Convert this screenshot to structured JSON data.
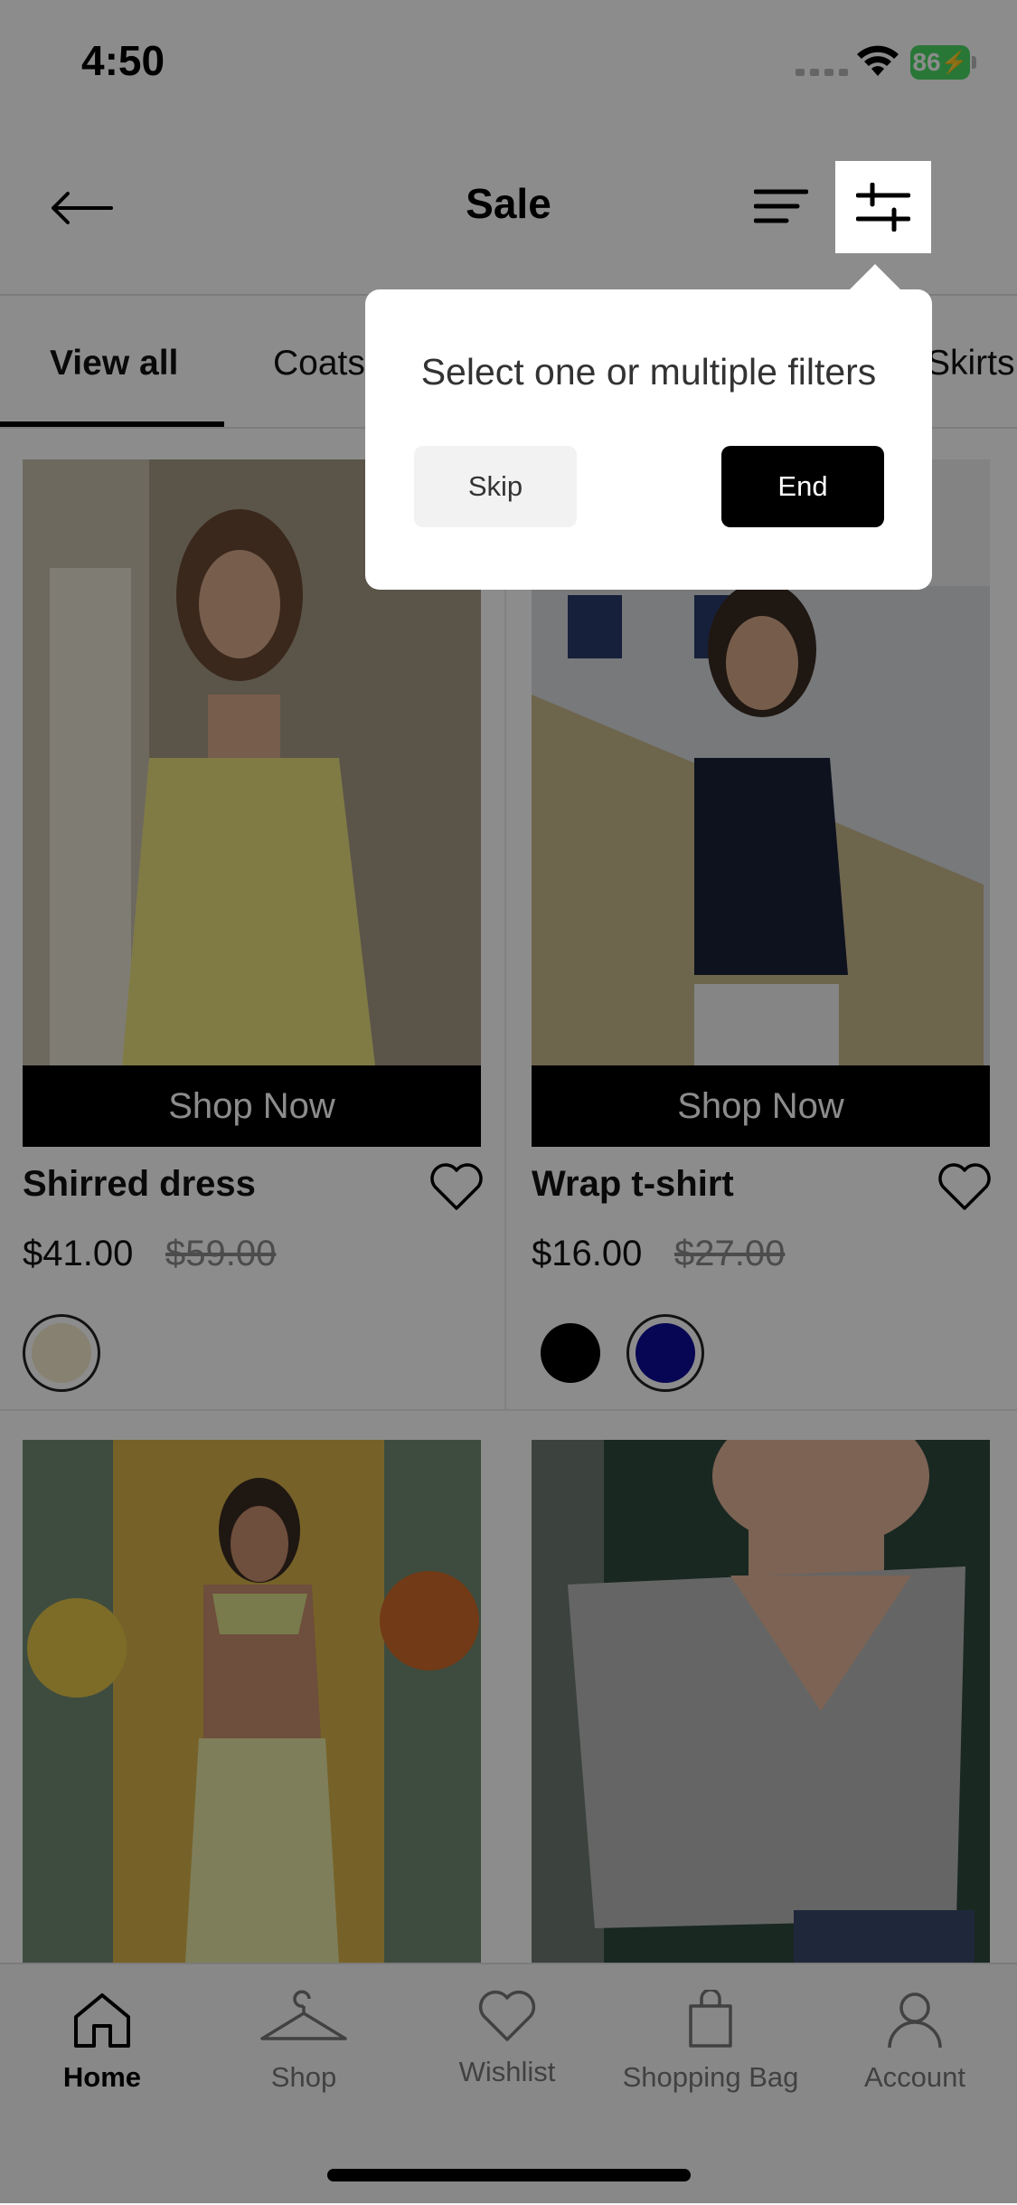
{
  "status_bar": {
    "time": "4:50",
    "battery": "86"
  },
  "header": {
    "title": "Sale",
    "back_icon": "arrow-left-icon",
    "sort_icon": "sort-lines-icon",
    "filter_icon": "sliders-icon"
  },
  "tabs": [
    {
      "label": "View all",
      "active": true
    },
    {
      "label": "Coats"
    },
    {
      "label": "Skirts"
    }
  ],
  "products": [
    {
      "name": "Shirred dress",
      "price": "$41.00",
      "old_price": "$59.00",
      "cta": "Shop Now",
      "swatches": [
        "#f4ebce"
      ]
    },
    {
      "name": "Wrap t-shirt",
      "price": "$16.00",
      "old_price": "$27.00",
      "cta": "Shop Now",
      "swatches": [
        "#000000",
        "#0b0b9a"
      ]
    }
  ],
  "bottom_nav": [
    {
      "label": "Home",
      "icon": "home-icon",
      "active": true
    },
    {
      "label": "Shop",
      "icon": "hanger-icon"
    },
    {
      "label": "Wishlist",
      "icon": "heart-icon"
    },
    {
      "label": "Shopping Bag",
      "icon": "bag-icon"
    },
    {
      "label": "Account",
      "icon": "user-icon"
    }
  ],
  "tooltip": {
    "text": "Select one or multiple filters",
    "skip_label": "Skip",
    "end_label": "End"
  }
}
